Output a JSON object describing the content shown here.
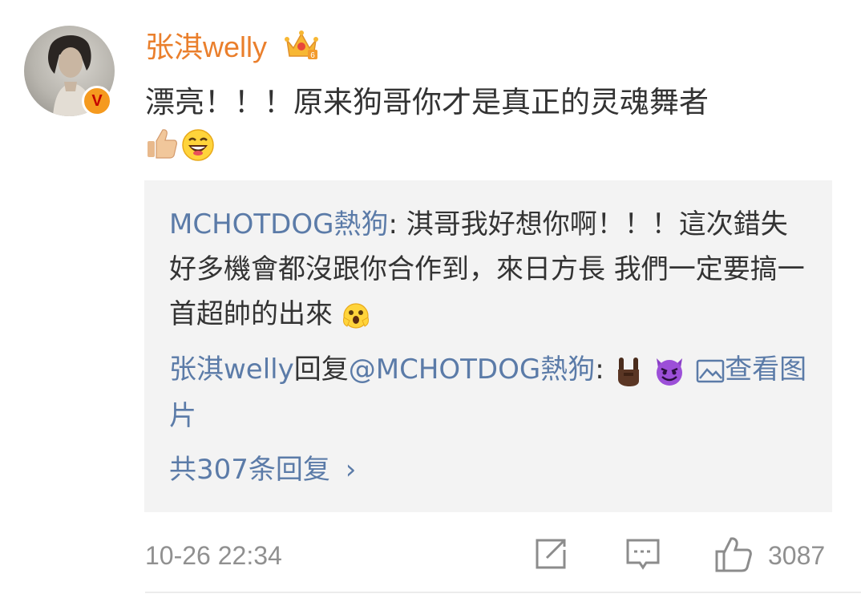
{
  "comment": {
    "username": "张淇welly",
    "text": "漂亮！！！原来狗哥你才是真正的灵魂舞者",
    "emojis": [
      "thumbs-up-icon",
      "grinning-face-icon"
    ],
    "verified_badge": "V",
    "level_badge": "crown-icon"
  },
  "replies": {
    "reply1_author": "MCHOTDOG熱狗",
    "reply1_sep": ": ",
    "reply1_text": "淇哥我好想你啊！！！這次錯失好多機會都沒跟你合作到，來日方長 我們一定要搞一首超帥的出來",
    "reply2_author": "张淇welly",
    "reply2_verb": "回复",
    "reply2_mention": "@MCHOTDOG熱狗",
    "reply2_sep": ":",
    "view_image": "查看图片",
    "more_replies": "共307条回复",
    "more_chevron": "›"
  },
  "footer": {
    "timestamp": "10-26 22:34",
    "like_count": "3087"
  },
  "colors": {
    "username": "#ea7f2c",
    "link": "#5b7ba8",
    "text": "#333333",
    "muted": "#909090",
    "reply_bg": "#f3f3f3"
  }
}
